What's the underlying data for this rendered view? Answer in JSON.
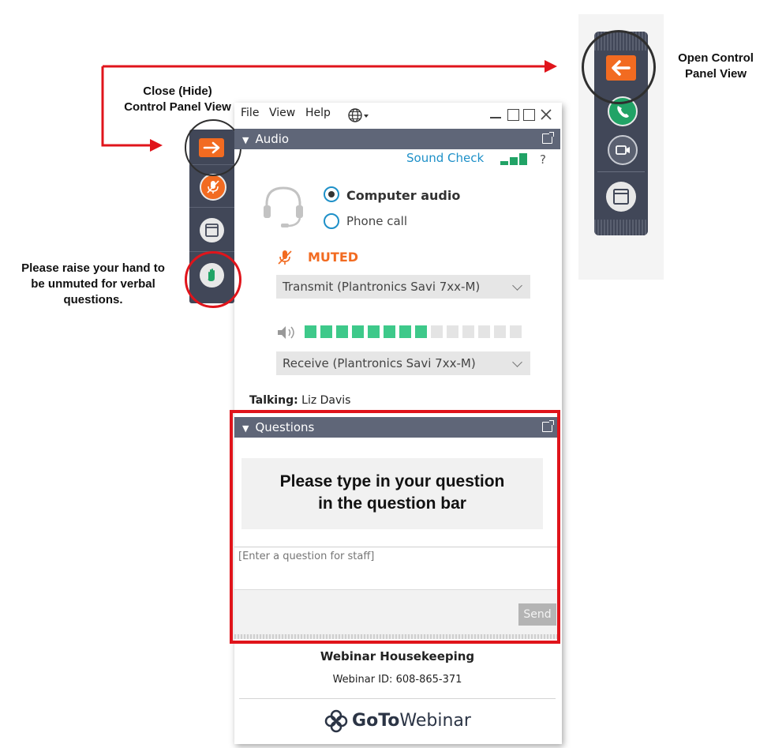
{
  "annotations": {
    "close_label_line1": "Close (Hide)",
    "close_label_line2": "Control Panel View",
    "open_label_line1": "Open Control",
    "open_label_line2": "Panel View",
    "raise_hand_line1": "Please raise your hand to",
    "raise_hand_line2": "be unmuted for verbal",
    "raise_hand_line3": "questions.",
    "question_tip_line1": "Please type in your question",
    "question_tip_line2": "in the question bar"
  },
  "menu": {
    "file": "File",
    "view": "View",
    "help": "Help"
  },
  "audio": {
    "header": "Audio",
    "sound_check": "Sound Check",
    "help_mark": "?",
    "option_computer": "Computer audio",
    "option_phone": "Phone call",
    "selected_option": "Computer audio",
    "mute_status": "MUTED",
    "transmit_device": "Transmit (Plantronics Savi 7xx-M)",
    "receive_device": "Receive (Plantronics Savi 7xx-M)",
    "volume_level": 0.57,
    "talking_label": "Talking:",
    "talking_name": "Liz Davis"
  },
  "questions": {
    "header": "Questions",
    "input_placeholder": "[Enter a question for staff]",
    "send_label": "Send"
  },
  "footer": {
    "webinar_title": "Webinar Housekeeping",
    "webinar_id": "Webinar ID: 608-865-371",
    "brand_bold": "GoTo",
    "brand_regular": "Webinar"
  },
  "colors": {
    "accent_orange": "#f26b21",
    "header_gray": "#5f6678",
    "toolbar_dark": "#414758",
    "highlight_red": "#e0141b",
    "sound_green": "#21a366",
    "link_blue": "#1e90c8"
  }
}
